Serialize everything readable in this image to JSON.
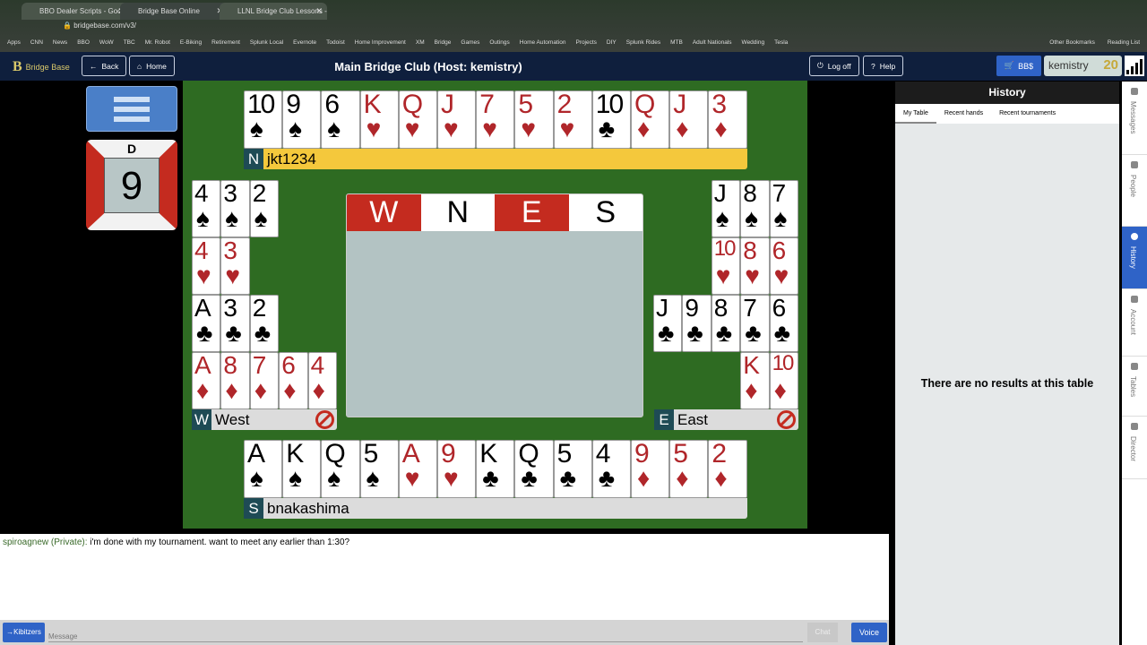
{
  "browser": {
    "tabs": [
      {
        "label": "BBO Dealer Scripts - Google S"
      },
      {
        "label": "Bridge Base Online"
      },
      {
        "label": "LLNL Bridge Club Lessons - C"
      }
    ],
    "url": "bridgebase.com/v3/",
    "bookmarks": [
      "Apps",
      "CNN",
      "News",
      "BBO",
      "WoW",
      "TBC",
      "Mr. Robot",
      "E-Biking",
      "Retirement",
      "Splunk Local",
      "Evernote",
      "Todoist",
      "Home Improvement",
      "XM",
      "Bridge",
      "Games",
      "Outings",
      "Home Automation",
      "Projects",
      "DIY",
      "Splunk Rides",
      "MTB",
      "Adult Nationals",
      "Wedding",
      "Tesla"
    ],
    "bookmarks_right": [
      "Other Bookmarks",
      "Reading List"
    ]
  },
  "header": {
    "logo": "Bridge Base",
    "back": "Back",
    "home": "Home",
    "title": "Main Bridge Club (Host: kemistry)",
    "logoff": "Log off",
    "help": "Help",
    "bbs": "BB$",
    "username": "kemistry",
    "level": "20"
  },
  "board": {
    "dealer": "D",
    "number": "9"
  },
  "hands": {
    "north": {
      "seat": "N",
      "name": "jkt1234",
      "cards": [
        {
          "rank": "10",
          "suit": "spade"
        },
        {
          "rank": "9",
          "suit": "spade"
        },
        {
          "rank": "6",
          "suit": "spade"
        },
        {
          "rank": "K",
          "suit": "heart"
        },
        {
          "rank": "Q",
          "suit": "heart"
        },
        {
          "rank": "J",
          "suit": "heart"
        },
        {
          "rank": "7",
          "suit": "heart"
        },
        {
          "rank": "5",
          "suit": "heart"
        },
        {
          "rank": "2",
          "suit": "heart"
        },
        {
          "rank": "10",
          "suit": "club"
        },
        {
          "rank": "Q",
          "suit": "diamond"
        },
        {
          "rank": "J",
          "suit": "diamond"
        },
        {
          "rank": "3",
          "suit": "diamond"
        }
      ]
    },
    "west": {
      "seat": "W",
      "name": "West",
      "suits": [
        [
          {
            "rank": "4",
            "suit": "spade"
          },
          {
            "rank": "3",
            "suit": "spade"
          },
          {
            "rank": "2",
            "suit": "spade"
          }
        ],
        [
          {
            "rank": "4",
            "suit": "heart"
          },
          {
            "rank": "3",
            "suit": "heart"
          }
        ],
        [
          {
            "rank": "A",
            "suit": "club"
          },
          {
            "rank": "3",
            "suit": "club"
          },
          {
            "rank": "2",
            "suit": "club"
          }
        ],
        [
          {
            "rank": "A",
            "suit": "diamond"
          },
          {
            "rank": "8",
            "suit": "diamond"
          },
          {
            "rank": "7",
            "suit": "diamond"
          },
          {
            "rank": "6",
            "suit": "diamond"
          },
          {
            "rank": "4",
            "suit": "diamond"
          }
        ]
      ]
    },
    "east": {
      "seat": "E",
      "name": "East",
      "suits": [
        [
          {
            "rank": "J",
            "suit": "spade"
          },
          {
            "rank": "8",
            "suit": "spade"
          },
          {
            "rank": "7",
            "suit": "spade"
          }
        ],
        [
          {
            "rank": "10",
            "suit": "heart"
          },
          {
            "rank": "8",
            "suit": "heart"
          },
          {
            "rank": "6",
            "suit": "heart"
          }
        ],
        [
          {
            "rank": "J",
            "suit": "club"
          },
          {
            "rank": "9",
            "suit": "club"
          },
          {
            "rank": "8",
            "suit": "club"
          },
          {
            "rank": "7",
            "suit": "club"
          },
          {
            "rank": "6",
            "suit": "club"
          }
        ],
        [
          {
            "rank": "K",
            "suit": "diamond"
          },
          {
            "rank": "10",
            "suit": "diamond"
          }
        ]
      ]
    },
    "south": {
      "seat": "S",
      "name": "bnakashima",
      "cards": [
        {
          "rank": "A",
          "suit": "spade"
        },
        {
          "rank": "K",
          "suit": "spade"
        },
        {
          "rank": "Q",
          "suit": "spade"
        },
        {
          "rank": "5",
          "suit": "spade"
        },
        {
          "rank": "A",
          "suit": "heart"
        },
        {
          "rank": "9",
          "suit": "heart"
        },
        {
          "rank": "K",
          "suit": "club"
        },
        {
          "rank": "Q",
          "suit": "club"
        },
        {
          "rank": "5",
          "suit": "club"
        },
        {
          "rank": "4",
          "suit": "club"
        },
        {
          "rank": "9",
          "suit": "diamond"
        },
        {
          "rank": "5",
          "suit": "diamond"
        },
        {
          "rank": "2",
          "suit": "diamond"
        }
      ]
    }
  },
  "bidding": {
    "seats": [
      {
        "label": "W",
        "vulnerable": true
      },
      {
        "label": "N",
        "vulnerable": false
      },
      {
        "label": "E",
        "vulnerable": true
      },
      {
        "label": "S",
        "vulnerable": false
      }
    ]
  },
  "colors": {
    "table": "#2e6b22",
    "vulnerable": "#c42b1f",
    "accent": "#2f63c7",
    "north_bar": "#f4c83c"
  },
  "chat": {
    "from": "spiroagnew (Private):",
    "text": "i'm done with my tournament. want to meet any earlier than 1:30?",
    "target": "→Kibitzers",
    "placeholder": "Message",
    "chat": "Chat",
    "voice": "Voice"
  },
  "panel": {
    "title": "History",
    "tabs": [
      "My Table",
      "Recent hands",
      "Recent tournaments"
    ],
    "empty": "There are no results at this table",
    "side_tabs": [
      "Messages",
      "People",
      "History",
      "Account",
      "Tables",
      "Director"
    ]
  }
}
